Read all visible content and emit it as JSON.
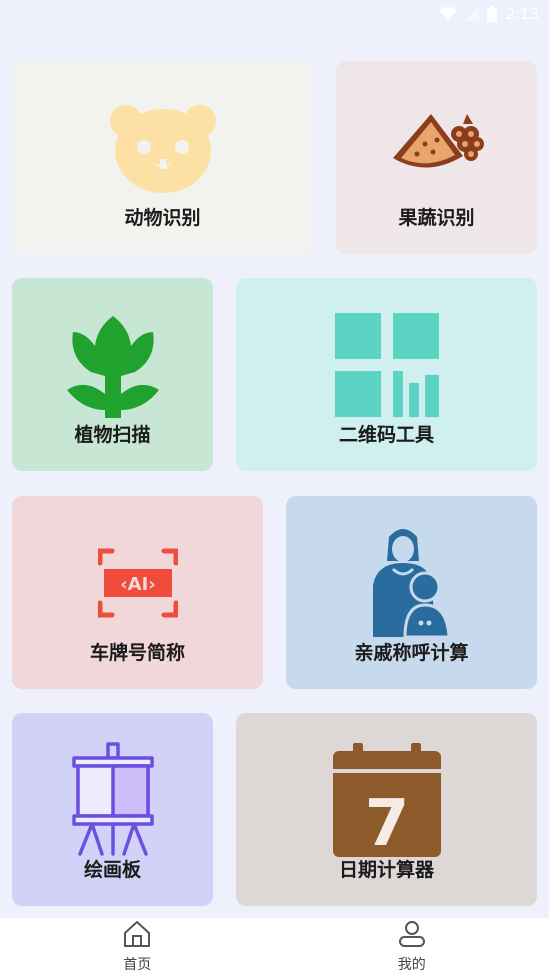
{
  "status_bar": {
    "time": "2:13"
  },
  "cards": [
    {
      "id": "animal",
      "label": "动物识别",
      "bg": "#f2f2ee",
      "icon": "panda-icon"
    },
    {
      "id": "fruit",
      "label": "果蔬识别",
      "bg": "#efe6ea",
      "icon": "fruit-icon"
    },
    {
      "id": "plant",
      "label": "植物扫描",
      "bg": "#c7e6d3",
      "icon": "plant-icon"
    },
    {
      "id": "qrcode",
      "label": "二维码工具",
      "bg": "#cff0ef",
      "icon": "qrcode-icon"
    },
    {
      "id": "plate",
      "label": "车牌号简称",
      "bg": "#f1d6da",
      "icon": "ai-scan-icon"
    },
    {
      "id": "relative",
      "label": "亲戚称呼计算",
      "bg": "#c7d9ec",
      "icon": "mother-child-icon"
    },
    {
      "id": "draw",
      "label": "绘画板",
      "bg": "#d2d2f8",
      "icon": "easel-icon"
    },
    {
      "id": "date",
      "label": "日期计算器",
      "bg": "#ddd8d6",
      "icon": "calendar-icon",
      "icon_text": "7"
    }
  ],
  "nav": {
    "home_label": "首页",
    "mine_label": "我的"
  }
}
